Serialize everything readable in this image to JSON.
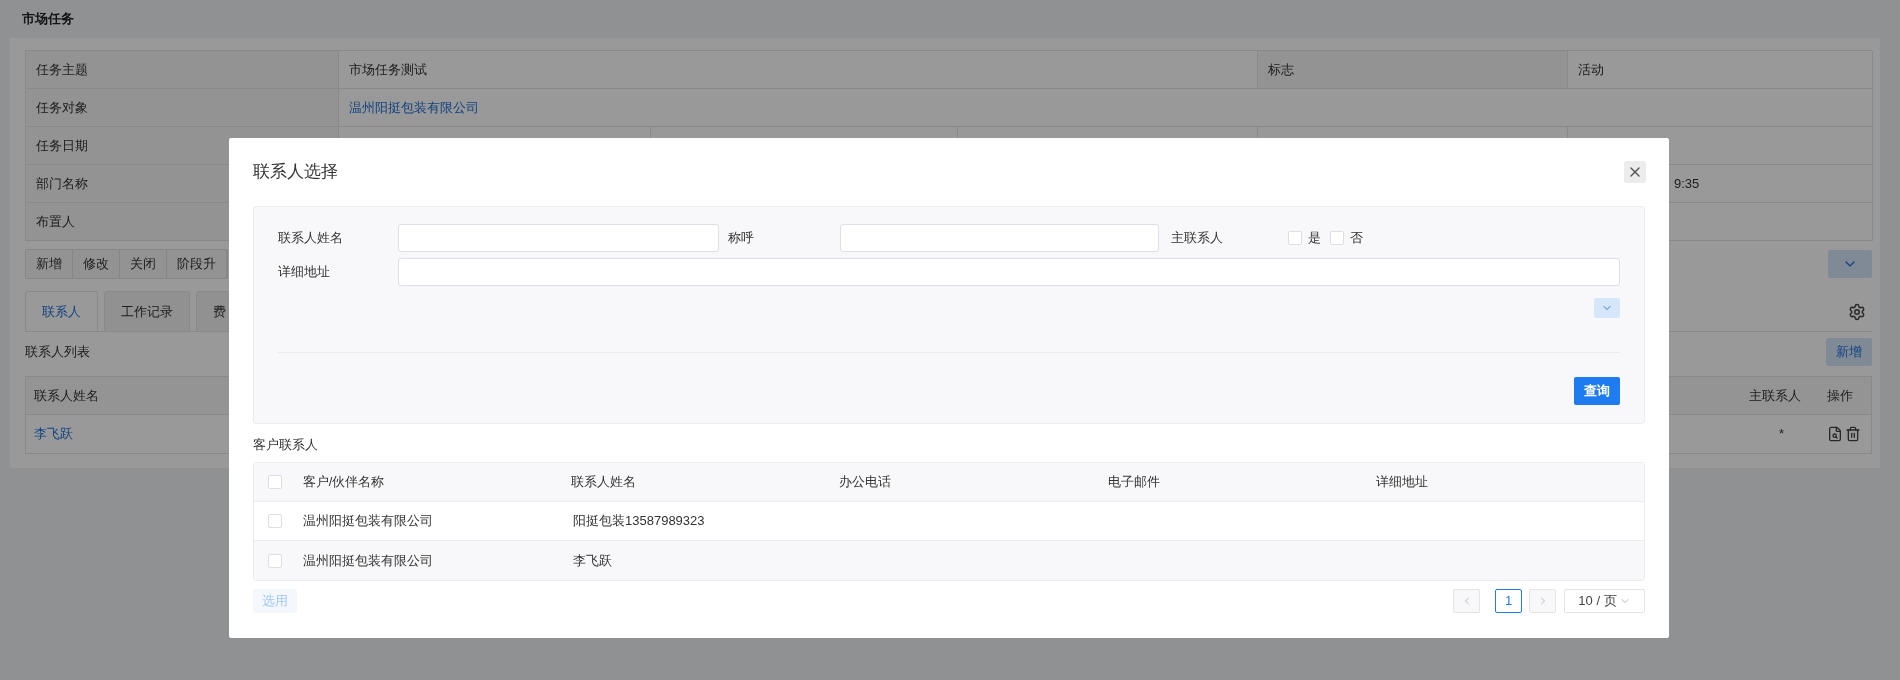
{
  "page": {
    "title": "市场任务"
  },
  "info_table": {
    "rows": [
      {
        "cells": [
          {
            "kind": "label",
            "text": "任务主题"
          },
          {
            "kind": "value",
            "text": "市场任务测试"
          },
          {
            "kind": "label",
            "text": "标志"
          },
          {
            "kind": "value",
            "text": "活动"
          }
        ]
      },
      {
        "cells": [
          {
            "kind": "label",
            "text": "任务对象"
          },
          {
            "kind": "link",
            "text": "温州阳挺包装有限公司"
          }
        ]
      },
      {
        "cells": [
          {
            "kind": "label",
            "text": "任务日期"
          }
        ]
      },
      {
        "cells": [
          {
            "kind": "label",
            "text": "部门名称"
          },
          {
            "kind": "value",
            "text": "9:35"
          }
        ]
      },
      {
        "cells": [
          {
            "kind": "label",
            "text": "布置人"
          }
        ]
      }
    ]
  },
  "actions": [
    "新增",
    "修改",
    "关闭",
    "阶段升"
  ],
  "tabs": [
    {
      "label": "联系人",
      "selected": true
    },
    {
      "label": "工作记录",
      "selected": false
    },
    {
      "label": "费",
      "selected": false
    }
  ],
  "contact_list": {
    "title": "联系人列表",
    "add_button": "新增",
    "columns": [
      "联系人姓名",
      "主联系人",
      "操作"
    ],
    "rows": [
      {
        "cells": [
          "李飞跃",
          "*"
        ]
      }
    ]
  },
  "dialog": {
    "title": "联系人选择",
    "filters": {
      "name_label": "联系人姓名",
      "salutation_label": "称呼",
      "primary_label": "主联系人",
      "primary_options": [
        {
          "label": "是",
          "checked": false
        },
        {
          "label": "否",
          "checked": false
        }
      ],
      "address_label": "详细地址",
      "search_button": "查询"
    },
    "section_title": "客户联系人",
    "table": {
      "all_checked": false,
      "columns": [
        "客户/伙伴名称",
        "联系人姓名",
        "办公电话",
        "电子邮件",
        "详细地址"
      ],
      "rows": [
        {
          "checked": false,
          "cells": [
            "温州阳挺包装有限公司",
            "阳挺包装13587989323"
          ]
        },
        {
          "checked": false,
          "cells": [
            "温州阳挺包装有限公司",
            "李飞跃"
          ]
        }
      ]
    },
    "select_button": {
      "label": "选用",
      "disabled": true
    },
    "pagination": {
      "pages": [
        {
          "label": "1",
          "selected": true
        }
      ],
      "page_size": "10 / 页"
    }
  }
}
